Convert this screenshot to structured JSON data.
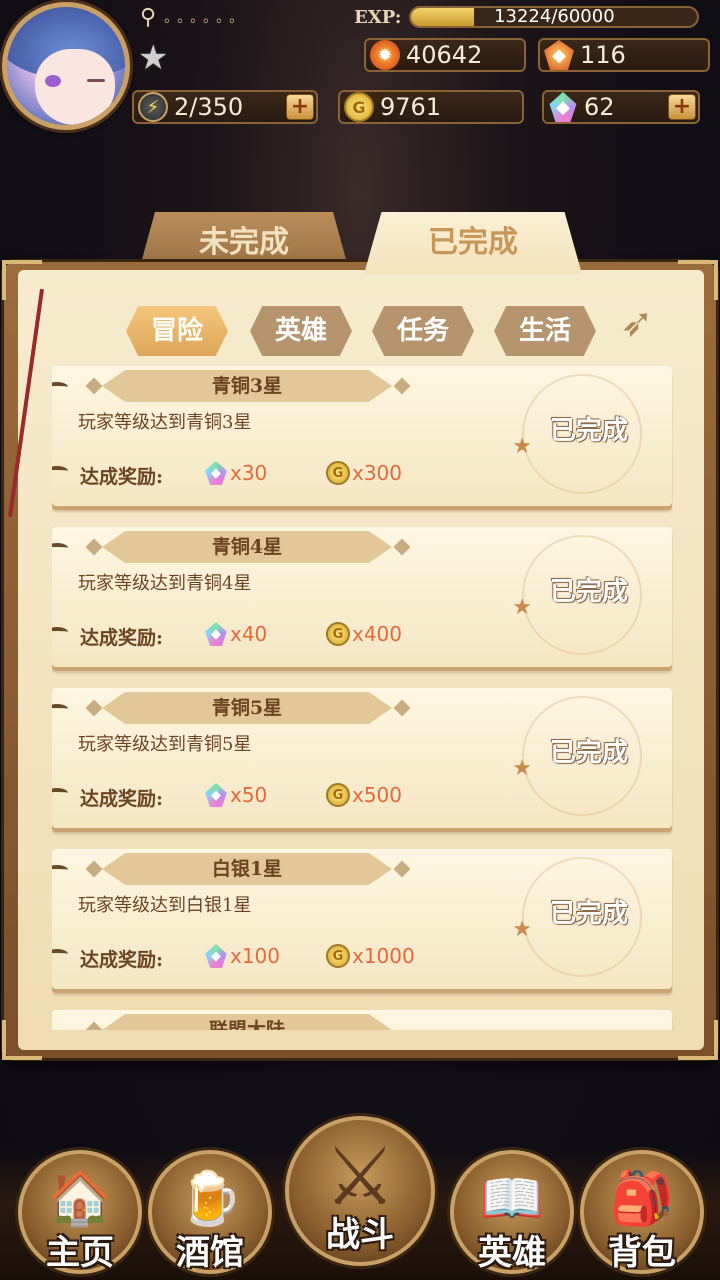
{
  "hud": {
    "exp_label": "EXP:",
    "exp_value": "13224/60000",
    "exp_progress": 0.2204,
    "search_dots": "。。。。。。",
    "fire_power": "40642",
    "ruby_count": "116",
    "energy": "2/350",
    "gold": "9761",
    "crystal": "62",
    "plus_symbol": "+"
  },
  "tabs": {
    "incomplete": "未完成",
    "complete": "已完成",
    "active": "complete"
  },
  "subtabs": [
    {
      "label": "冒险",
      "active": true
    },
    {
      "label": "英雄",
      "active": false
    },
    {
      "label": "任务",
      "active": false
    },
    {
      "label": "生活",
      "active": false
    }
  ],
  "achievements": [
    {
      "title": "青铜3星",
      "desc": "玩家等级达到青铜3星",
      "reward_label": "达成奖励:",
      "crystal": "x30",
      "gold": "x300",
      "status": "已完成"
    },
    {
      "title": "青铜4星",
      "desc": "玩家等级达到青铜4星",
      "reward_label": "达成奖励:",
      "crystal": "x40",
      "gold": "x400",
      "status": "已完成"
    },
    {
      "title": "青铜5星",
      "desc": "玩家等级达到青铜5星",
      "reward_label": "达成奖励:",
      "crystal": "x50",
      "gold": "x500",
      "status": "已完成"
    },
    {
      "title": "白银1星",
      "desc": "玩家等级达到白银1星",
      "reward_label": "达成奖励:",
      "crystal": "x100",
      "gold": "x1000",
      "status": "已完成"
    },
    {
      "title": "联盟大陆",
      "desc": "",
      "reward_label": "",
      "crystal": "",
      "gold": "",
      "status": ""
    }
  ],
  "nav": {
    "home": "主页",
    "tavern": "酒馆",
    "battle": "战斗",
    "heroes": "英雄",
    "bag": "背包"
  },
  "colors": {
    "panel_bg": "#f7ebcf",
    "reward_text": "#e46a3c",
    "active_subtab": "#dca55a"
  }
}
